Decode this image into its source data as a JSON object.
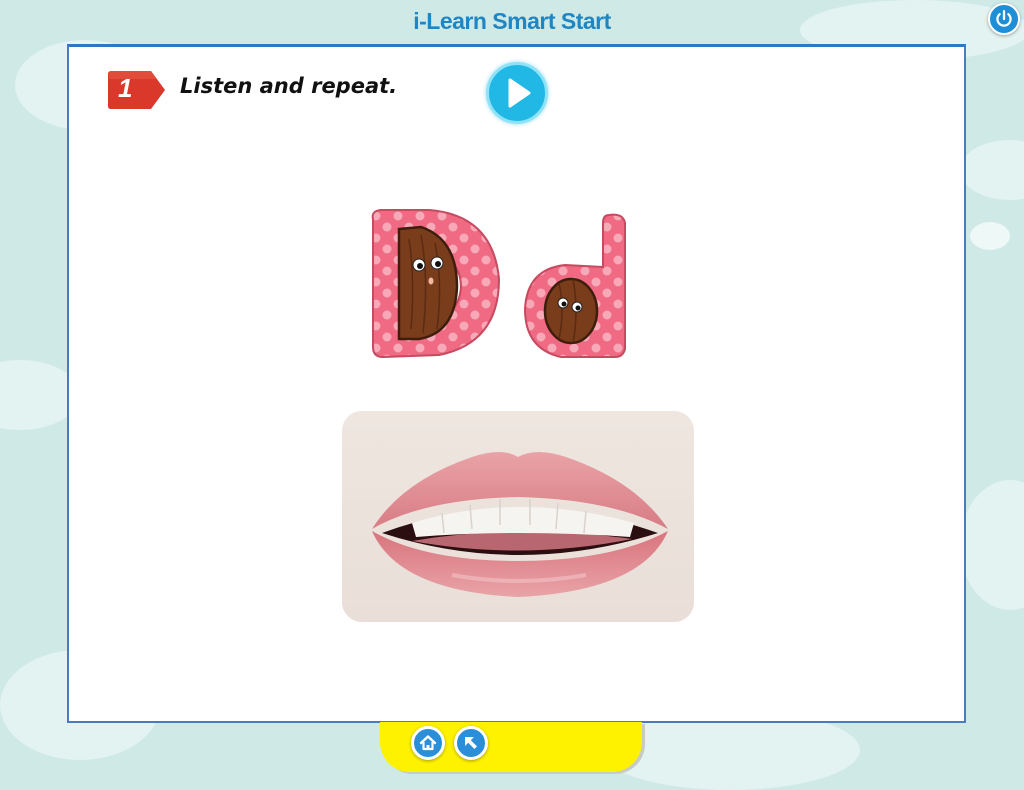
{
  "header": {
    "title": "i-Learn Smart Start"
  },
  "lesson": {
    "activity_number": "1",
    "instruction": "Listen and repeat.",
    "letter_text": "Dd"
  },
  "icons": {
    "power": "power-icon",
    "play": "play-icon",
    "home": "home-icon",
    "back": "arrow-back-icon"
  },
  "colors": {
    "background": "#cfe9e6",
    "title": "#1f86c4",
    "badge": "#d9382b",
    "play_button": "#22b8e6",
    "bottom_bar": "#fff200",
    "nav_button": "#2a8fd8",
    "letter_pink": "#ef6a82"
  }
}
